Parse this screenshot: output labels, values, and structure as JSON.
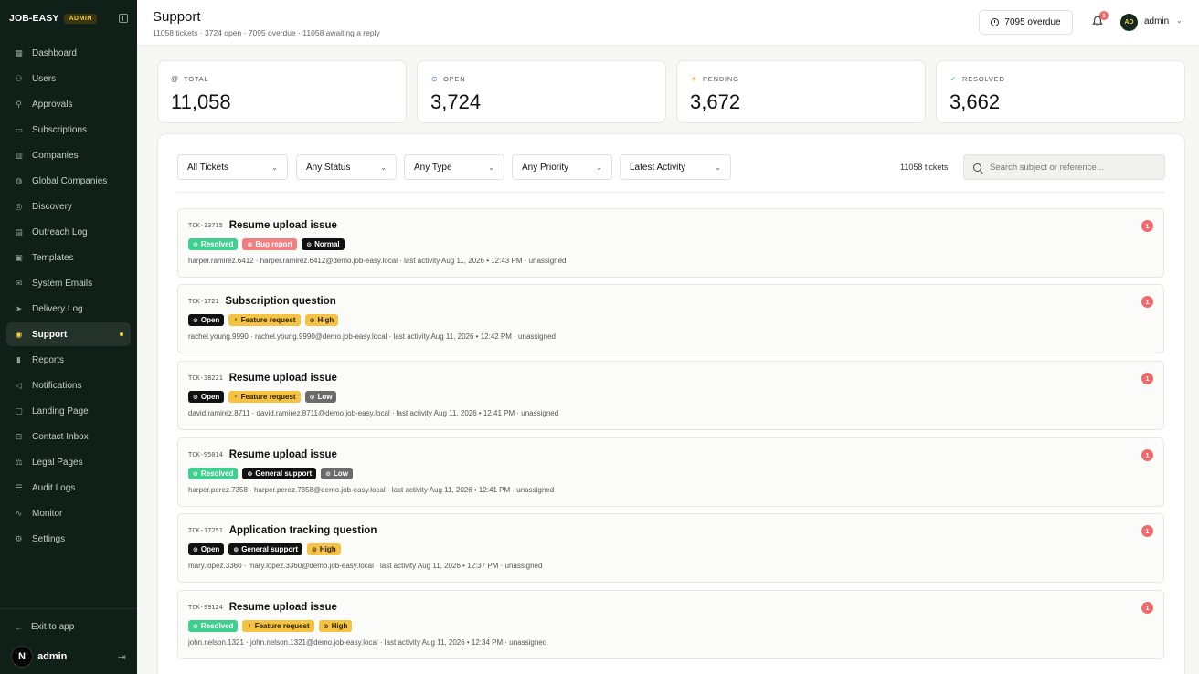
{
  "brand": {
    "name": "JOB-EASY",
    "badge": "ADMIN"
  },
  "sidebar": {
    "items": [
      {
        "label": "Dashboard",
        "icon": "dashboard-icon"
      },
      {
        "label": "Users",
        "icon": "users-icon"
      },
      {
        "label": "Approvals",
        "icon": "user-check-icon"
      },
      {
        "label": "Subscriptions",
        "icon": "credit-card-icon"
      },
      {
        "label": "Companies",
        "icon": "building-icon"
      },
      {
        "label": "Global Companies",
        "icon": "globe-icon"
      },
      {
        "label": "Discovery",
        "icon": "compass-icon"
      },
      {
        "label": "Outreach Log",
        "icon": "inbox-icon"
      },
      {
        "label": "Templates",
        "icon": "template-icon"
      },
      {
        "label": "System Emails",
        "icon": "mail-icon"
      },
      {
        "label": "Delivery Log",
        "icon": "send-icon"
      },
      {
        "label": "Support",
        "icon": "lifebuoy-icon",
        "active": true
      },
      {
        "label": "Reports",
        "icon": "chart-icon"
      },
      {
        "label": "Notifications",
        "icon": "megaphone-icon"
      },
      {
        "label": "Landing Page",
        "icon": "layout-icon"
      },
      {
        "label": "Contact Inbox",
        "icon": "contact-inbox-icon"
      },
      {
        "label": "Legal Pages",
        "icon": "scale-icon"
      },
      {
        "label": "Audit Logs",
        "icon": "file-list-icon"
      },
      {
        "label": "Monitor",
        "icon": "activity-icon"
      },
      {
        "label": "Settings",
        "icon": "gear-icon"
      }
    ],
    "exit_label": "Exit to app",
    "user": {
      "initial": "N",
      "name": "admin"
    }
  },
  "header": {
    "title": "Support",
    "subtitle": "11058 tickets · 3724 open · 7095 overdue · 11058 awaiting a reply",
    "overdue_label": "7095 overdue",
    "notif_count": "1",
    "avatar_initials": "AD",
    "user_name": "admin"
  },
  "stats": [
    {
      "label": "TOTAL",
      "value": "11,058",
      "icon": "at-icon",
      "color": "#555555"
    },
    {
      "label": "OPEN",
      "value": "3,724",
      "icon": "circle-dot-icon",
      "color": "#3b6fd4"
    },
    {
      "label": "PENDING",
      "value": "3,672",
      "icon": "loader-icon",
      "color": "#e6a23c"
    },
    {
      "label": "RESOLVED",
      "value": "3,662",
      "icon": "check-circle-icon",
      "color": "#2fbf7a"
    }
  ],
  "filters": {
    "tickets": "All Tickets",
    "status": "Any Status",
    "type": "Any Type",
    "priority": "Any Priority",
    "sort": "Latest Activity",
    "count_text": "11058 tickets",
    "search_placeholder": "Search subject or reference..."
  },
  "tickets": [
    {
      "ref": "TCK-13715",
      "subject": "Resume upload issue",
      "tags": [
        {
          "label": "Resolved",
          "kind": "resolved"
        },
        {
          "label": "Bug report",
          "kind": "bug"
        },
        {
          "label": "Normal",
          "kind": "normal"
        }
      ],
      "meta": "harper.ramirez.6412 · harper.ramirez.6412@demo.job-easy.local · last activity Aug 11, 2026 • 12:43 PM · unassigned",
      "badge": "1"
    },
    {
      "ref": "TCK-1721",
      "subject": "Subscription question",
      "tags": [
        {
          "label": "Open",
          "kind": "open"
        },
        {
          "label": "Feature request",
          "kind": "feature"
        },
        {
          "label": "High",
          "kind": "high"
        }
      ],
      "meta": "rachel.young.9990 · rachel.young.9990@demo.job-easy.local · last activity Aug 11, 2026 • 12:42 PM · unassigned",
      "badge": "1"
    },
    {
      "ref": "TCK-38221",
      "subject": "Resume upload issue",
      "tags": [
        {
          "label": "Open",
          "kind": "open"
        },
        {
          "label": "Feature request",
          "kind": "feature"
        },
        {
          "label": "Low",
          "kind": "low"
        }
      ],
      "meta": "david.ramirez.8711 · david.ramirez.8711@demo.job-easy.local · last activity Aug 11, 2026 • 12:41 PM · unassigned",
      "badge": "1"
    },
    {
      "ref": "TCK-95014",
      "subject": "Resume upload issue",
      "tags": [
        {
          "label": "Resolved",
          "kind": "resolved"
        },
        {
          "label": "General support",
          "kind": "general"
        },
        {
          "label": "Low",
          "kind": "low"
        }
      ],
      "meta": "harper.perez.7358 · harper.perez.7358@demo.job-easy.local · last activity Aug 11, 2026 • 12:41 PM · unassigned",
      "badge": "1"
    },
    {
      "ref": "TCK-17251",
      "subject": "Application tracking question",
      "tags": [
        {
          "label": "Open",
          "kind": "open"
        },
        {
          "label": "General support",
          "kind": "general"
        },
        {
          "label": "High",
          "kind": "high"
        }
      ],
      "meta": "mary.lopez.3360 · mary.lopez.3360@demo.job-easy.local · last activity Aug 11, 2026 • 12:37 PM · unassigned",
      "badge": "1"
    },
    {
      "ref": "TCK-99124",
      "subject": "Resume upload issue",
      "tags": [
        {
          "label": "Resolved",
          "kind": "resolved"
        },
        {
          "label": "Feature request",
          "kind": "feature"
        },
        {
          "label": "High",
          "kind": "high"
        }
      ],
      "meta": "john.nelson.1321 · john.nelson.1321@demo.job-easy.local · last activity Aug 11, 2026 • 12:34 PM · unassigned",
      "badge": "1"
    }
  ]
}
